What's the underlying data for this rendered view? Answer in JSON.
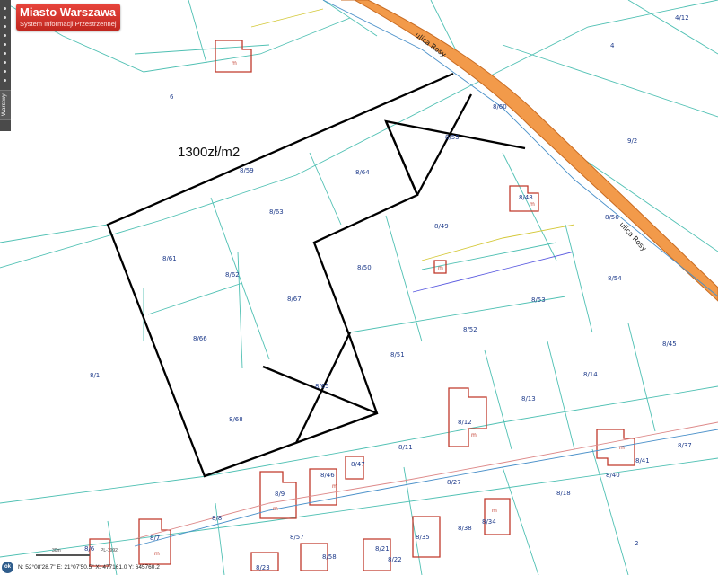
{
  "logo": {
    "title": "Miasto Warszawa",
    "subtitle": "System Informacji Przestrzennej"
  },
  "sidebar": {
    "layers_tab": "Warstwy"
  },
  "annotation": {
    "price": "1300zł/m2"
  },
  "street": {
    "name": "ulica Rosy"
  },
  "parcels": [
    "8/59",
    "8/60",
    "8/64",
    "8/63",
    "8/61",
    "8/62",
    "8/67",
    "8/50",
    "8/49",
    "8/48",
    "8/55",
    "8/56",
    "8/54",
    "8/53",
    "8/52",
    "8/66",
    "8/51",
    "8/65",
    "8/68",
    "8/1",
    "8/11",
    "8/12",
    "8/13",
    "8/14",
    "8/45",
    "8/37",
    "8/40",
    "8/41",
    "8/27",
    "8/47",
    "8/46",
    "8/9",
    "8/8",
    "8/7",
    "8/6",
    "8/18",
    "8/34",
    "8/35",
    "8/38",
    "8/21",
    "8/23",
    "8/22",
    "8/57",
    "8/58",
    "6",
    "4",
    "4/12",
    "9/2",
    "2"
  ],
  "building_label": "m",
  "colors": {
    "parcel_line": "#4fc0b3",
    "road_fill": "#f29a4a",
    "outline": "#000000",
    "building": "#c0392b",
    "label": "#1d3a8a"
  },
  "status": {
    "ok_label": "ok",
    "coords": "N: 52°08'28.7\"  E: 21°07'50.5\"   X: 477161.0   Y: 645760.2",
    "scale": "30m",
    "crs": "PL-1992"
  }
}
